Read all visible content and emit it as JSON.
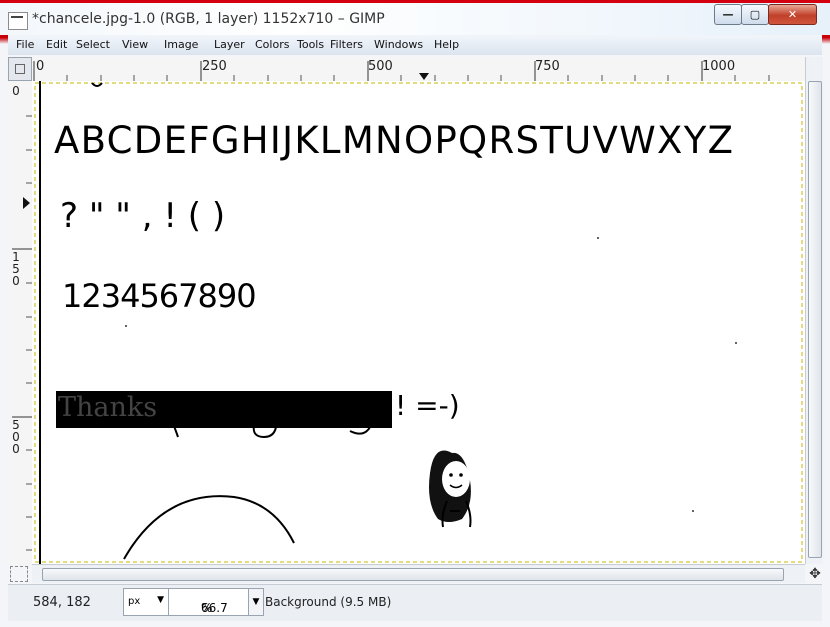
{
  "window": {
    "title": "*chancele.jpg-1.0 (RGB, 1 layer) 1152x710 – GIMP",
    "minimize_symbol": "—",
    "maximize_symbol": "▢",
    "close_symbol": "✕"
  },
  "menubar": {
    "items": [
      "File",
      "Edit",
      "Select",
      "View",
      "Image",
      "Layer",
      "Colors",
      "Tools",
      "Filters",
      "Windows",
      "Help"
    ]
  },
  "ruler": {
    "horizontal_labels": [
      "0",
      "250",
      "500",
      "750",
      "1000"
    ],
    "vertical_labels": [
      "0",
      "150",
      "500"
    ]
  },
  "canvas": {
    "drawing_text": {
      "alphabet": "ABCDEFGHIJKLMNOPQRSTUVWXYZ",
      "punctuation": "? \" \" , ! ( )",
      "digits": "1234567890",
      "thanks": "Thanks",
      "smiley": "! =-)"
    }
  },
  "statusbar": {
    "coords": "584, 182",
    "unit": "px",
    "zoom": "66.7",
    "zoom_unit": "%",
    "layer_info": "Background (9.5 MB)"
  },
  "colors": {
    "titlebar_red": "#d40010",
    "canvas_bg": "#ffffff",
    "ink": "#000000"
  }
}
